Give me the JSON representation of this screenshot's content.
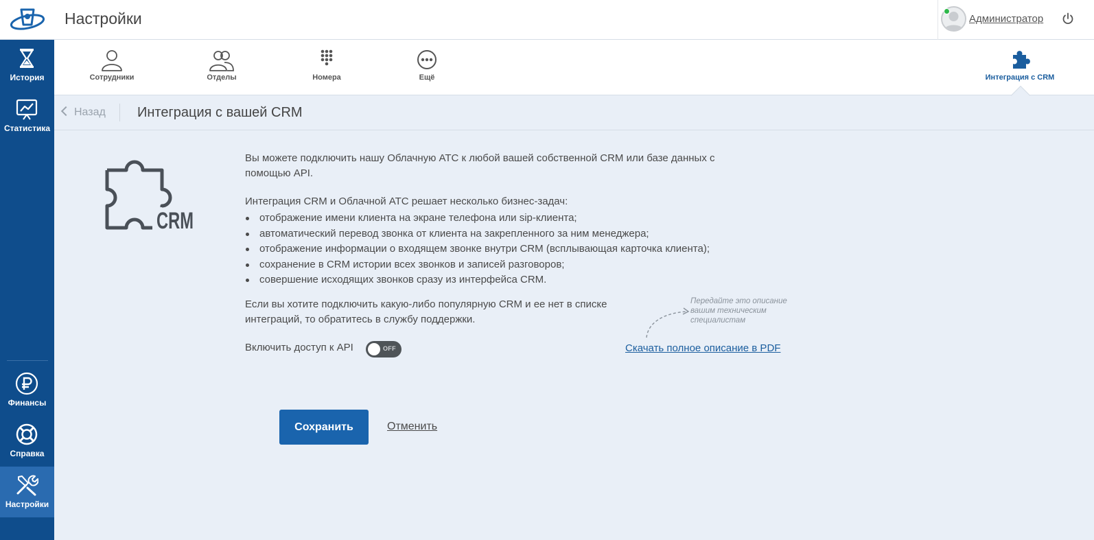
{
  "header": {
    "title": "Настройки",
    "user_name": "Администратор"
  },
  "sidebar": {
    "items": [
      {
        "label": "История",
        "icon": "hourglass-icon"
      },
      {
        "label": "Статистика",
        "icon": "chart-icon"
      },
      {
        "label": "Финансы",
        "icon": "ruble-icon"
      },
      {
        "label": "Справка",
        "icon": "lifebuoy-icon"
      },
      {
        "label": "Настройки",
        "icon": "tools-icon",
        "active": true
      }
    ]
  },
  "tabs": [
    {
      "label": "Сотрудники",
      "icon": "user-icon"
    },
    {
      "label": "Отделы",
      "icon": "users-icon"
    },
    {
      "label": "Номера",
      "icon": "dialpad-icon"
    },
    {
      "label": "Ещё",
      "icon": "more-icon"
    },
    {
      "label": "Интеграция с CRM",
      "icon": "puzzle-icon",
      "active": true
    }
  ],
  "breadcrumb": {
    "back_label": "Назад",
    "title": "Интеграция с вашей CRM"
  },
  "content": {
    "logo_text": "CRM",
    "intro": "Вы можете подключить нашу Облачную АТС к любой вашей собственной CRM или базе данных с помощью API.",
    "tasks_heading": "Интеграция CRM и Облачной АТС решает несколько бизнес-задач:",
    "tasks": [
      "отображение имени клиента на экране телефона или sip-клиента;",
      "автоматический перевод звонка от клиента на закрепленного за ним менеджера;",
      "отображение информации о входящем звонке внутри CRM (всплывающая карточка клиента);",
      "сохранение в CRM истории всех звонков и записей разговоров;",
      "совершение исходящих звонков сразу из интерфейса CRM."
    ],
    "support_note": "Если вы хотите подключить какую-либо популярную CRM и ее нет в списке интеграций, то обратитесь в службу поддержки.",
    "hint": "Передайте это описание вашим техническим специалистам",
    "pdf_link": "Скачать полное описание в PDF",
    "api_label": "Включить доступ к API",
    "api_toggle_state": "OFF"
  },
  "actions": {
    "save": "Сохранить",
    "cancel": "Отменить"
  },
  "colors": {
    "sidebar": "#0f4d8c",
    "sidebar_active": "#2a6bb0",
    "accent": "#1a64ad",
    "background": "#e9eff7"
  }
}
